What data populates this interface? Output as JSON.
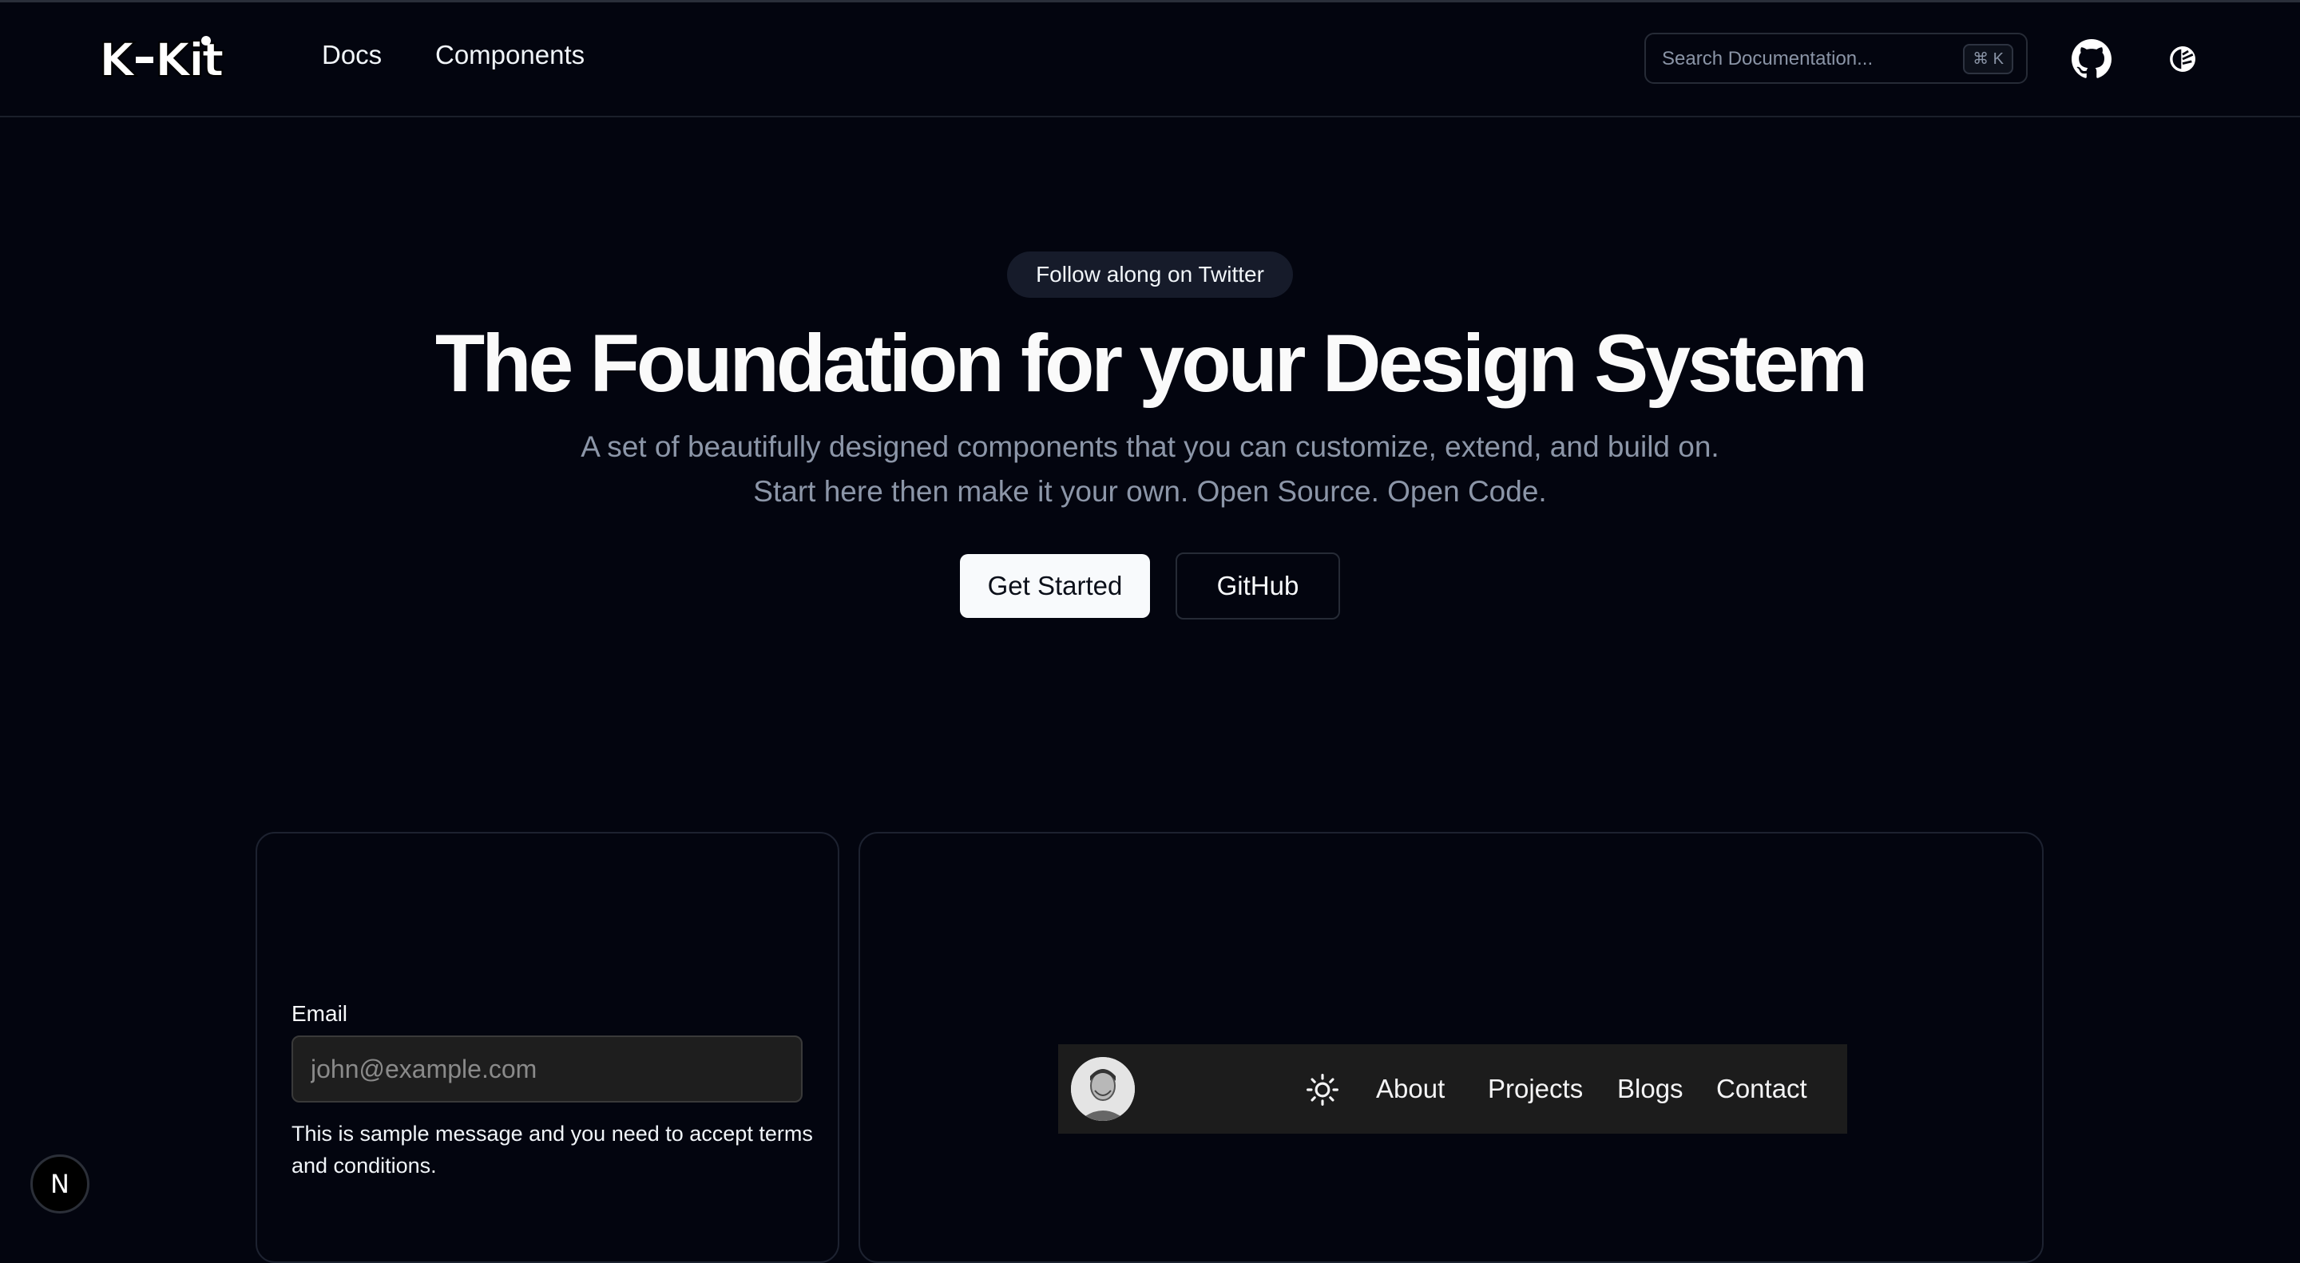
{
  "header": {
    "logo_text": "K-Kit",
    "nav": [
      "Docs",
      "Components"
    ],
    "search": {
      "placeholder": "Search Documentation...",
      "shortcut": "⌘ K"
    },
    "github_icon": "github-icon",
    "theme_icon": "theme-toggle-icon"
  },
  "hero": {
    "badge": "Follow along on Twitter",
    "title": "The Foundation for your Design System",
    "subtitle_line1": "A set of beautifully designed components that you can customize, extend, and build on.",
    "subtitle_line2": "Start here then make it your own. Open Source. Open Code.",
    "primary_button": "Get Started",
    "secondary_button": "GitHub"
  },
  "form_card": {
    "label": "Email",
    "placeholder": "john@example.com",
    "help": "This is sample message and you need to accept terms and conditions."
  },
  "preview_card": {
    "nav_links": [
      "About",
      "Projects",
      "Blogs",
      "Contact"
    ],
    "theme_icon": "sun-icon",
    "avatar": "avatar"
  },
  "floating_badge": "N",
  "colors": {
    "background": "#03050f",
    "border": "#1d2230",
    "muted_text": "#8c96a8",
    "primary_button_bg": "#f8fafc"
  }
}
